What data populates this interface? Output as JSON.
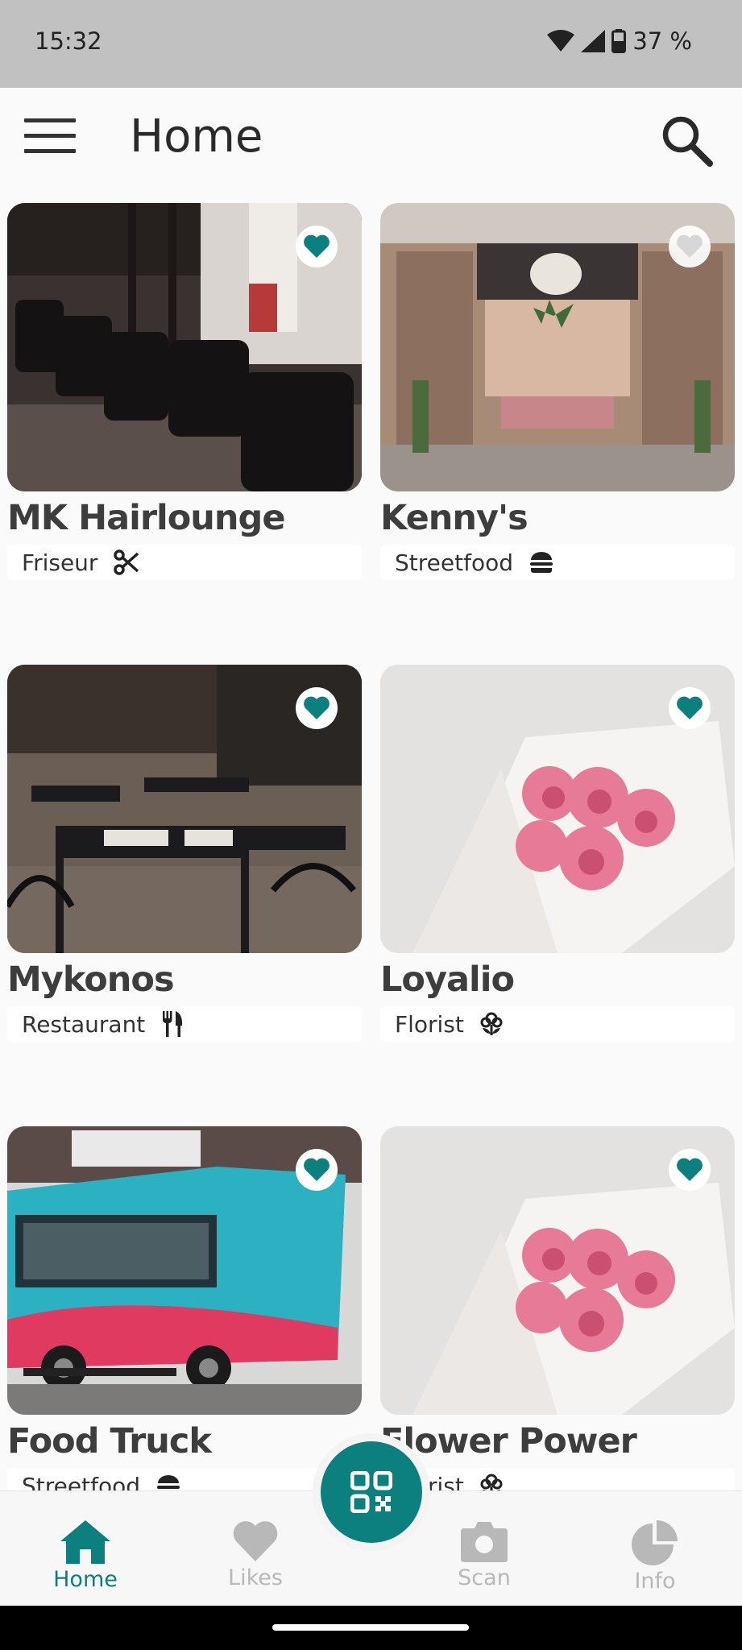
{
  "status": {
    "time": "15:32",
    "battery": "37 %"
  },
  "appbar": {
    "title": "Home"
  },
  "cards": [
    {
      "name": "MK Hairlounge",
      "category": "Friseur",
      "category_icon": "scissors-icon",
      "favorite": true
    },
    {
      "name": "Kenny's",
      "category": "Streetfood",
      "category_icon": "burger-icon",
      "favorite": false
    },
    {
      "name": "Mykonos",
      "category": "Restaurant",
      "category_icon": "cutlery-icon",
      "favorite": true
    },
    {
      "name": "Loyalio",
      "category": "Florist",
      "category_icon": "flower-icon",
      "favorite": true
    },
    {
      "name": "Food Truck",
      "category": "Streetfood",
      "category_icon": "burger-icon",
      "favorite": true
    },
    {
      "name": "Flower Power",
      "category": "Florist",
      "category_icon": "flower-icon",
      "favorite": true
    }
  ],
  "nav": {
    "home": "Home",
    "likes": "Likes",
    "scan": "Scan",
    "info": "Info"
  },
  "colors": {
    "accent": "#0c7f7f",
    "inactive": "#b8b8b8",
    "statusbar": "#c1c1c1"
  }
}
